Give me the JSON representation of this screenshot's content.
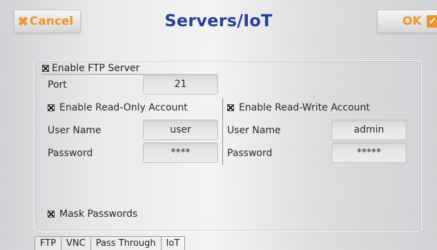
{
  "header": {
    "cancel_label": "Cancel",
    "title": "Servers/IoT",
    "ok_label": "OK"
  },
  "ftp": {
    "enable_ftp_label": "Enable FTP Server",
    "enable_ftp_checked": true,
    "port_label": "Port",
    "port_value": "21",
    "readonly": {
      "enable_label": "Enable Read-Only Account",
      "checked": true,
      "username_label": "User Name",
      "username_value": "user",
      "password_label": "Password",
      "password_value": "****"
    },
    "readwrite": {
      "enable_label": "Enable Read-Write Account",
      "checked": true,
      "username_label": "User Name",
      "username_value": "admin",
      "password_label": "Password",
      "password_value": "*****"
    },
    "mask_passwords_label": "Mask Passwords",
    "mask_passwords_checked": true
  },
  "tabs": [
    {
      "label": "FTP",
      "active": true
    },
    {
      "label": "VNC",
      "active": false
    },
    {
      "label": "Pass Through",
      "active": false
    },
    {
      "label": "IoT",
      "active": false
    }
  ],
  "colors": {
    "accent_orange": "#f0932a",
    "title_blue": "#25419a"
  },
  "icons": {
    "cancel": "x-icon",
    "ok": "check-icon",
    "checkbox": "checkbox-checked-icon"
  }
}
